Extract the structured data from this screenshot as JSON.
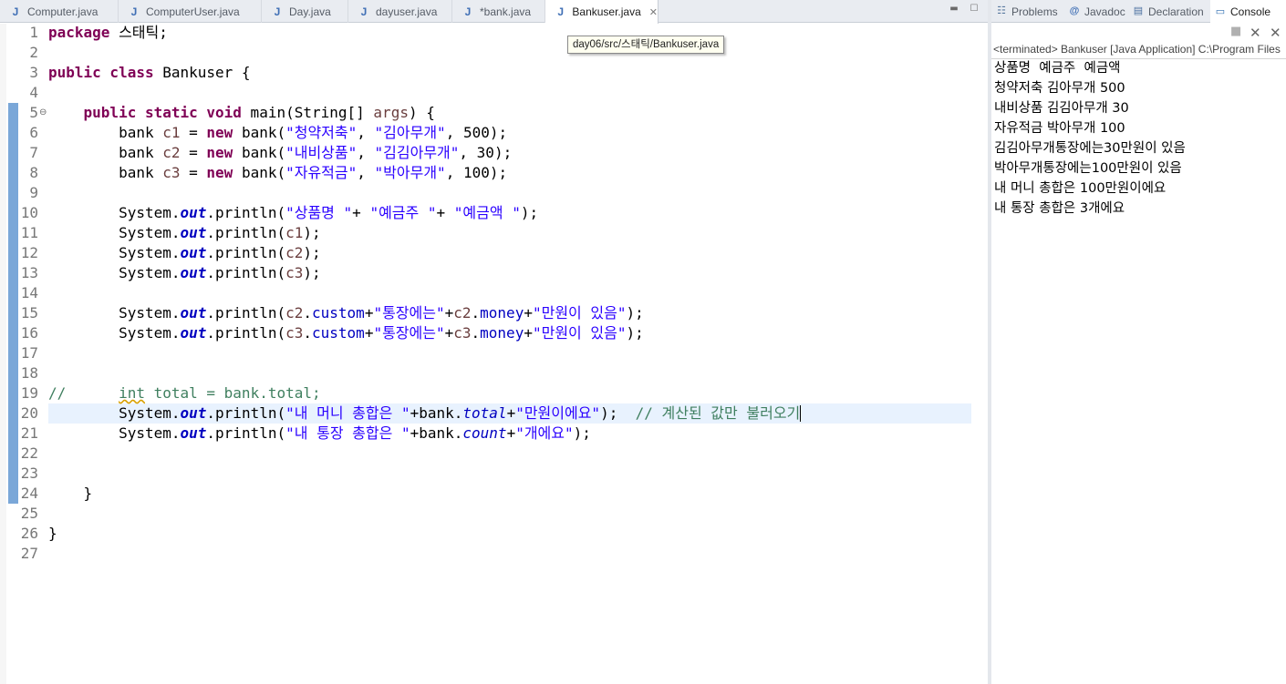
{
  "editor_tabs": [
    {
      "label": "Computer.java",
      "icon": "java-file-icon"
    },
    {
      "label": "ComputerUser.java",
      "icon": "java-file-icon"
    },
    {
      "label": "Day.java",
      "icon": "java-file-icon"
    },
    {
      "label": "dayuser.java",
      "icon": "java-file-icon"
    },
    {
      "label": "*bank.java",
      "icon": "java-file-icon"
    },
    {
      "label": "Bankuser.java",
      "icon": "java-file-icon",
      "active": true
    }
  ],
  "java_icon_glyph": "J",
  "tooltip": "day06/src/스태틱/Bankuser.java",
  "code": {
    "line_numbers": [
      "1",
      "2",
      "3",
      "4",
      "5",
      "6",
      "7",
      "8",
      "9",
      "10",
      "11",
      "12",
      "13",
      "14",
      "15",
      "16",
      "17",
      "18",
      "19",
      "20",
      "21",
      "22",
      "23",
      "24",
      "25",
      "26",
      "27"
    ],
    "lines": {
      "l1": {
        "kw": "package",
        "rest": " 스태틱;"
      },
      "l3": {
        "kw": "public class",
        "rest": " Bankuser {"
      },
      "l5": {
        "indent": "    ",
        "kw": "public static void",
        "rest": " main(String[] ",
        "var": "args",
        "end": ") {"
      },
      "l6": {
        "a": "        bank ",
        "var": "c1",
        "b": " = ",
        "kw": "new",
        "c": " bank(",
        "s1": "\"청약저축\"",
        "d": ", ",
        "s2": "\"김아무개\"",
        "e": ", 500);"
      },
      "l7": {
        "a": "        bank ",
        "var": "c2",
        "b": " = ",
        "kw": "new",
        "c": " bank(",
        "s1": "\"내비상품\"",
        "d": ", ",
        "s2": "\"김김아무개\"",
        "e": ", 30);"
      },
      "l8": {
        "a": "        bank ",
        "var": "c3",
        "b": " = ",
        "kw": "new",
        "c": " bank(",
        "s1": "\"자유적금\"",
        "d": ", ",
        "s2": "\"박아무개\"",
        "e": ", 100);"
      },
      "l10": {
        "a": "        System.",
        "f": "out",
        "b": ".println(",
        "s1": "\"상품명 \"",
        "c": "+ ",
        "s2": "\"예금주 \"",
        "d": "+ ",
        "s3": "\"예금액 \"",
        "e": ");"
      },
      "l11": {
        "a": "        System.",
        "f": "out",
        "b": ".println(",
        "var": "c1",
        "e": ");"
      },
      "l12": {
        "a": "        System.",
        "f": "out",
        "b": ".println(",
        "var": "c2",
        "e": ");"
      },
      "l13": {
        "a": "        System.",
        "f": "out",
        "b": ".println(",
        "var": "c3",
        "e": ");"
      },
      "l15": {
        "a": "        System.",
        "f": "out",
        "b": ".println(",
        "var1": "c2",
        "dot1": ".",
        "fld1": "custom",
        "p1": "+",
        "s1": "\"통장에는\"",
        "p2": "+",
        "var2": "c2",
        "dot2": ".",
        "fld2": "money",
        "p3": "+",
        "s2": "\"만원이 있음\"",
        "e": ");"
      },
      "l16": {
        "a": "        System.",
        "f": "out",
        "b": ".println(",
        "var1": "c3",
        "dot1": ".",
        "fld1": "custom",
        "p1": "+",
        "s1": "\"통장에는\"",
        "p2": "+",
        "var2": "c3",
        "dot2": ".",
        "fld2": "money",
        "p3": "+",
        "s2": "\"만원이 있음\"",
        "e": ");"
      },
      "l19": {
        "cmt1": "//      ",
        "warn": "int",
        "cmt2": " total = bank.total;"
      },
      "l20": {
        "a": "        System.",
        "f": "out",
        "b": ".println(",
        "s1": "\"내 머니 총합은 \"",
        "c": "+bank.",
        "sf": "total",
        "d": "+",
        "s2": "\"만원이에요\"",
        "e": ");  ",
        "cmt": "// 계산된 값만 불러오기"
      },
      "l21": {
        "a": "        System.",
        "f": "out",
        "b": ".println(",
        "s1": "\"내 통장 총합은 \"",
        "c": "+bank.",
        "sf": "count",
        "d": "+",
        "s2": "\"개에요\"",
        "e": ");"
      },
      "l24": {
        "text": "    }"
      },
      "l26": {
        "text": "}"
      }
    }
  },
  "view_tabs": [
    {
      "label": "Problems",
      "icon": "problems-icon"
    },
    {
      "label": "Javadoc",
      "icon": "javadoc-icon"
    },
    {
      "label": "Declaration",
      "icon": "declaration-icon"
    },
    {
      "label": "Console",
      "icon": "console-icon",
      "active": true
    }
  ],
  "console": {
    "description": "<terminated> Bankuser [Java Application] C:\\Program Files",
    "output": [
      "상품명  예금주  예금액",
      "청약저축 김아무개 500",
      "내비상품 김김아무개 30",
      "자유적금 박아무개 100",
      "김김아무개통장에는30만원이 있음",
      "박아무개통장에는100만원이 있음",
      "내 머니 총합은 100만원이에요",
      "내 통장 총합은 3개에요"
    ]
  },
  "colors": {
    "keyword": "#7f0055",
    "string": "#2a00ff",
    "field": "#0000c0",
    "local_variable": "#6a3e3e",
    "comment": "#3f7f5f",
    "current_line": "#e8f2fe",
    "change_bar": "#7aa7d8"
  }
}
